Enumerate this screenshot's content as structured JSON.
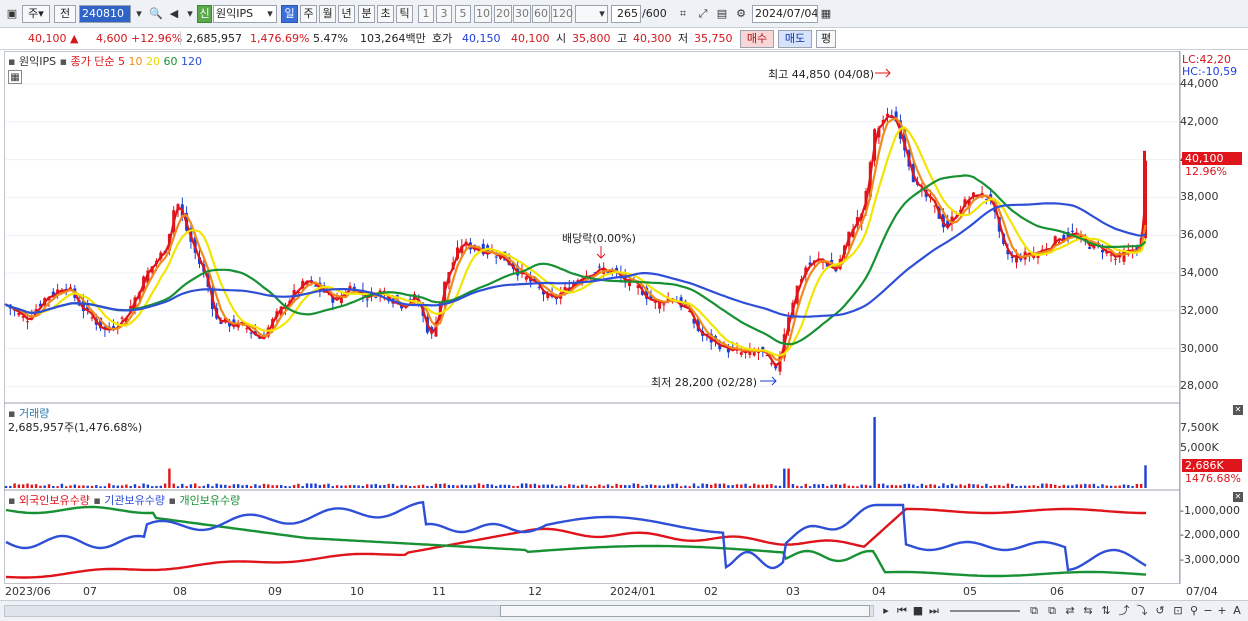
{
  "toolbar": {
    "period_label": "주",
    "prev_label": "전",
    "code_value": "240810",
    "stock_badge": "신",
    "stock_name": "원익IPS",
    "timeframes": [
      "일",
      "주",
      "월",
      "년",
      "분",
      "초",
      "틱"
    ],
    "intervals": [
      "1",
      "3",
      "5",
      "10",
      "20",
      "30",
      "60",
      "120"
    ],
    "count_value": "265",
    "count_max": "/600",
    "date_value": "2024/07/04"
  },
  "info": {
    "price": "40,100",
    "change": "4,600",
    "change_pct": "+12.96%",
    "volume": "2,685,957",
    "volume_pct": "1,476.69%",
    "turnover_pct": "5.47%",
    "amount": "103,264백만",
    "quote_label": "호가",
    "ask": "40,150",
    "bid": "40,100",
    "open_label": "시",
    "open": "35,800",
    "high_label": "고",
    "high": "40,300",
    "low_label": "저",
    "low": "35,750",
    "buy_label": "매수",
    "sell_label": "매도",
    "eval_label": "평"
  },
  "price_panel": {
    "name": "원익IPS",
    "ma_title": "종가 단순",
    "ma_periods": [
      "5",
      "10",
      "20",
      "60",
      "120"
    ],
    "lc": "LC:42,20",
    "hc": "HC:-10,59",
    "high_annot": "최고 44,850 (04/08)",
    "low_annot": "최저 28,200 (02/28)",
    "div_annot": "배당락(0.00%)",
    "price_tag": "40,100",
    "pct_tag": "12.96%",
    "y_ticks": [
      "44,000",
      "42,000",
      "40,000",
      "38,000",
      "36,000",
      "34,000",
      "32,000",
      "30,000",
      "28,000"
    ]
  },
  "volume_panel": {
    "name": "거래량",
    "value": "2,685,957주(1,476.68%)",
    "y_ticks": [
      "7,500K",
      "5,000K"
    ],
    "vol_tag": "2,686K",
    "pct_tag": "1476.68%"
  },
  "holding_panel": {
    "foreign": "외국인보유수량",
    "inst": "기관보유수량",
    "retail": "개인보유수량",
    "y_ticks": [
      "-1,000,000",
      "-2,000,000",
      "-3,000,000"
    ]
  },
  "x_ticks": [
    "2023/06",
    "07",
    "08",
    "09",
    "10",
    "11",
    "12",
    "2024/01",
    "02",
    "03",
    "04",
    "05",
    "06",
    "07",
    "07/04"
  ],
  "colors": {
    "up": "#e0141b",
    "down": "#1b3fd6",
    "ma5": "#e0141b",
    "ma10": "#f08a1c",
    "ma20": "#f2e600",
    "ma60": "#179133",
    "ma120": "#2e4fd6"
  },
  "chart_data": {
    "type": "candlestick",
    "price_range": [
      27500,
      45500
    ],
    "close_points": [
      [
        0,
        32200
      ],
      [
        20,
        31400
      ],
      [
        40,
        32600
      ],
      [
        60,
        33200
      ],
      [
        80,
        31800
      ],
      [
        100,
        30800
      ],
      [
        120,
        31600
      ],
      [
        140,
        33800
      ],
      [
        160,
        35200
      ],
      [
        170,
        37800
      ],
      [
        180,
        36200
      ],
      [
        190,
        34800
      ],
      [
        200,
        33600
      ],
      [
        210,
        31400
      ],
      [
        225,
        31200
      ],
      [
        240,
        31000
      ],
      [
        255,
        30400
      ],
      [
        270,
        31600
      ],
      [
        285,
        32600
      ],
      [
        300,
        33400
      ],
      [
        315,
        33000
      ],
      [
        330,
        32400
      ],
      [
        345,
        33200
      ],
      [
        360,
        32600
      ],
      [
        375,
        32900
      ],
      [
        395,
        32200
      ],
      [
        410,
        32600
      ],
      [
        425,
        30400
      ],
      [
        440,
        33600
      ],
      [
        455,
        35400
      ],
      [
        470,
        35200
      ],
      [
        485,
        35000
      ],
      [
        500,
        34600
      ],
      [
        515,
        33800
      ],
      [
        530,
        33200
      ],
      [
        545,
        32400
      ],
      [
        560,
        33000
      ],
      [
        575,
        33700
      ],
      [
        590,
        34000
      ],
      [
        605,
        34000
      ],
      [
        620,
        33400
      ],
      [
        635,
        33000
      ],
      [
        650,
        32200
      ],
      [
        665,
        32600
      ],
      [
        680,
        32000
      ],
      [
        695,
        30600
      ],
      [
        710,
        30200
      ],
      [
        725,
        29800
      ],
      [
        740,
        29600
      ],
      [
        755,
        29800
      ],
      [
        770,
        28600
      ],
      [
        780,
        31200
      ],
      [
        790,
        33000
      ],
      [
        800,
        34200
      ],
      [
        815,
        34600
      ],
      [
        830,
        34000
      ],
      [
        845,
        36200
      ],
      [
        858,
        37200
      ],
      [
        868,
        41200
      ],
      [
        878,
        42000
      ],
      [
        888,
        42200
      ],
      [
        898,
        40600
      ],
      [
        910,
        38400
      ],
      [
        925,
        37600
      ],
      [
        940,
        36200
      ],
      [
        955,
        37400
      ],
      [
        970,
        38000
      ],
      [
        985,
        37800
      ],
      [
        995,
        35400
      ],
      [
        1005,
        34600
      ],
      [
        1020,
        34800
      ],
      [
        1035,
        35000
      ],
      [
        1050,
        35600
      ],
      [
        1065,
        36000
      ],
      [
        1080,
        35400
      ],
      [
        1095,
        35200
      ],
      [
        1110,
        34600
      ],
      [
        1125,
        35000
      ],
      [
        1135,
        35400
      ],
      [
        1140,
        40100
      ]
    ],
    "volume_x": [
      0,
      1140
    ],
    "volume_peaks": [
      [
        163,
        2300
      ],
      [
        780,
        2300
      ],
      [
        868,
        8400
      ],
      [
        1140,
        2686
      ]
    ]
  }
}
